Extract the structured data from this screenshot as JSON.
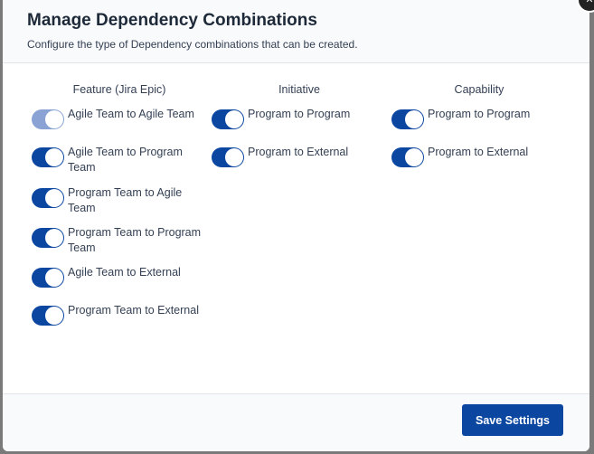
{
  "dialog": {
    "title": "Manage Dependency Combinations",
    "subtitle": "Configure the type of Dependency combinations that can be created.",
    "save_label": "Save Settings",
    "close_icon": "close-icon"
  },
  "columns": [
    {
      "heading": "Feature (Jira Epic)",
      "items": [
        {
          "label": "Agile Team to Agile Team",
          "on": true,
          "disabled": true
        },
        {
          "label": "Agile Team to Program Team",
          "on": true,
          "disabled": false
        },
        {
          "label": "Program Team to Agile Team",
          "on": true,
          "disabled": false
        },
        {
          "label": "Program Team to Program Team",
          "on": true,
          "disabled": false
        },
        {
          "label": "Agile Team to External",
          "on": true,
          "disabled": false
        },
        {
          "label": "Program Team to External",
          "on": true,
          "disabled": false
        }
      ]
    },
    {
      "heading": "Initiative",
      "items": [
        {
          "label": "Program to Program",
          "on": true,
          "disabled": false
        },
        {
          "label": "Program to External",
          "on": true,
          "disabled": false
        }
      ]
    },
    {
      "heading": "Capability",
      "items": [
        {
          "label": "Program to Program",
          "on": true,
          "disabled": false
        },
        {
          "label": "Program to External",
          "on": true,
          "disabled": false
        }
      ]
    }
  ],
  "colors": {
    "accent": "#0b47a1",
    "disabled_toggle": "#8aa3d4"
  }
}
